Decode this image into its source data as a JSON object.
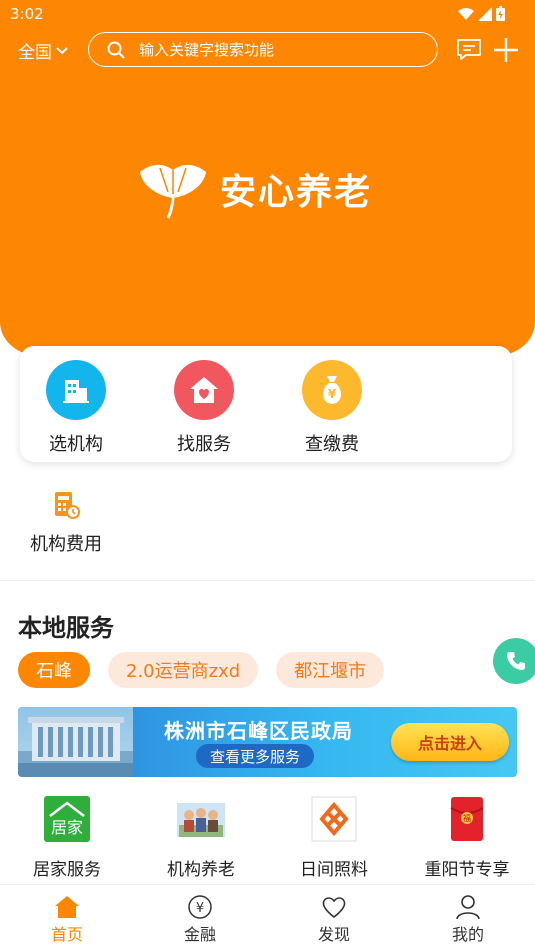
{
  "status": {
    "time": "3:02"
  },
  "header": {
    "region": "全国",
    "search_placeholder": "输入关键字搜索功能"
  },
  "brand": {
    "name": "安心养老"
  },
  "quick_actions": [
    {
      "label": "选机构",
      "icon": "building-icon",
      "color": "#13b6ec"
    },
    {
      "label": "找服务",
      "icon": "home-heart-icon",
      "color": "#f2565e"
    },
    {
      "label": "查缴费",
      "icon": "money-bag-icon",
      "color": "#fdb92d"
    }
  ],
  "extra_action": {
    "label": "机构费用",
    "icon": "fee-calculator-icon",
    "color": "#f7931e"
  },
  "local_services": {
    "title": "本地服务",
    "chips": [
      {
        "label": "石峰",
        "active": true
      },
      {
        "label": "2.0运营商zxd",
        "active": false
      },
      {
        "label": "都江堰市",
        "active": false
      }
    ]
  },
  "banner": {
    "title": "株洲市石峰区民政局",
    "subtitle": "查看更多服务",
    "button": "点击进入"
  },
  "services": [
    {
      "label": "居家服务",
      "icon": "home-care-icon",
      "icon_text": "居家"
    },
    {
      "label": "机构养老",
      "icon": "institution-care-icon"
    },
    {
      "label": "日间照料",
      "icon": "day-care-icon"
    },
    {
      "label": "重阳节专享",
      "icon": "red-envelope-icon",
      "icon_text": "福"
    }
  ],
  "tabbar": [
    {
      "label": "首页",
      "icon": "home-icon",
      "active": true
    },
    {
      "label": "金融",
      "icon": "yuan-coin-icon",
      "active": false
    },
    {
      "label": "发现",
      "icon": "heart-icon",
      "active": false
    },
    {
      "label": "我的",
      "icon": "user-icon",
      "active": false
    }
  ],
  "colors": {
    "primary": "#fd8603",
    "chip_bg": "#fde9dc",
    "fab": "#3ccca4"
  }
}
